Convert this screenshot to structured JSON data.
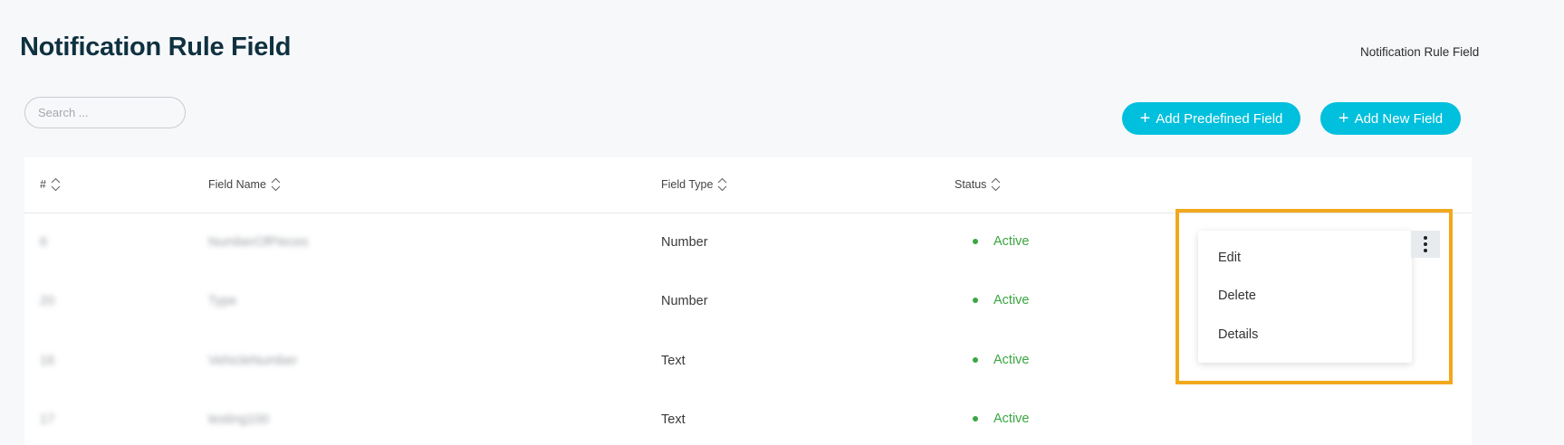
{
  "header": {
    "title": "Notification Rule Field",
    "breadcrumb": "Notification Rule Field"
  },
  "search": {
    "placeholder": "Search ...",
    "value": ""
  },
  "actions": {
    "add_predefined": "Add Predefined Field",
    "add_new": "Add New Field"
  },
  "table": {
    "columns": [
      "#",
      "Field Name",
      "Field Type",
      "Status"
    ],
    "rows": [
      {
        "id": "6",
        "field_name": "NumberOfPieces",
        "field_type": "Number",
        "status": "Active"
      },
      {
        "id": "20",
        "field_name": "Type",
        "field_type": "Number",
        "status": "Active"
      },
      {
        "id": "16",
        "field_name": "VehicleNumber",
        "field_type": "Text",
        "status": "Active"
      },
      {
        "id": "17",
        "field_name": "testing100",
        "field_type": "Text",
        "status": "Active"
      }
    ]
  },
  "row_menu": {
    "items": [
      "Edit",
      "Delete",
      "Details"
    ]
  },
  "colors": {
    "accent": "#00c0dd",
    "title": "#0f3140",
    "status_active": "#3aa642",
    "highlight": "#f2a81d"
  },
  "icons": {
    "sort": "sort-updown-icon",
    "kebab": "more-vertical-icon",
    "plus": "plus-icon"
  }
}
